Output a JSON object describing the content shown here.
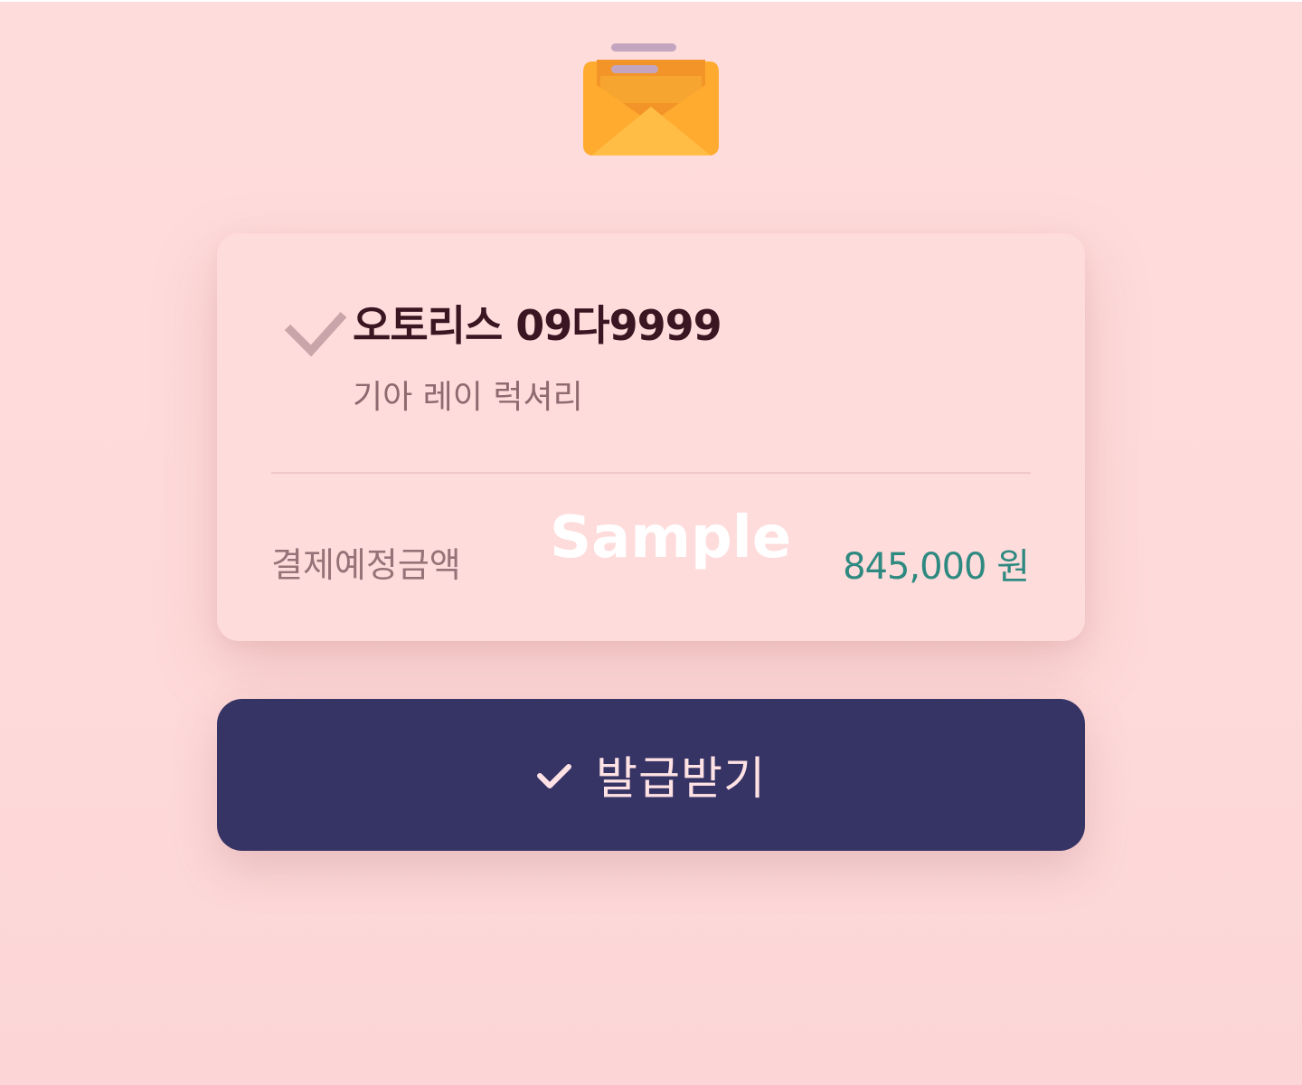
{
  "vehicle": {
    "plate": "오토리스 09다9999",
    "model": "기아 레이 럭셔리"
  },
  "payment": {
    "label": "결제예정금액",
    "amount": "845,000 원"
  },
  "watermark": "Sample",
  "issue_button": {
    "label": "발급받기"
  },
  "colors": {
    "background": "#ffdcdc",
    "button": "#363365",
    "amount": "#2e8a80",
    "envelope": "#ffaa30"
  },
  "icons": {
    "header": "mail-open-icon",
    "selected": "check-icon",
    "button": "check-icon"
  }
}
